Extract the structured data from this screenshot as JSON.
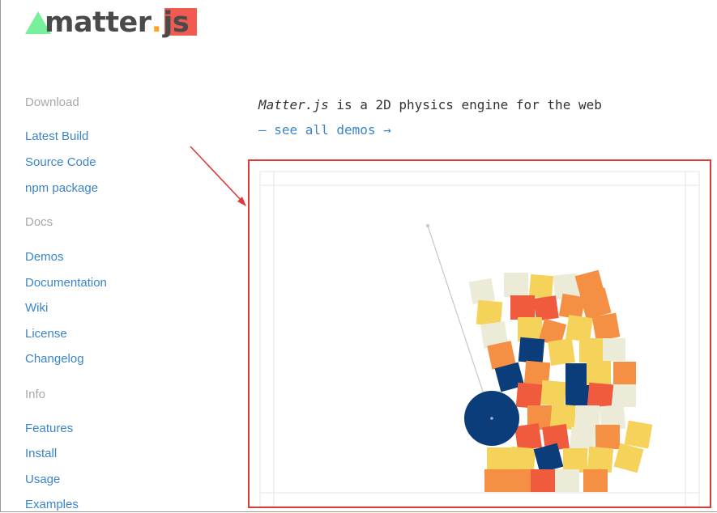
{
  "logo": {
    "word": "matter",
    "dot": ".",
    "js": "js",
    "colors": {
      "triangle": "#76f09b",
      "dot": "#f5a623",
      "js_bg": "#f05a4f",
      "text": "#4a4a4a"
    }
  },
  "sidebar": {
    "sections": [
      {
        "heading": "Download",
        "links": [
          "Latest Build",
          "Source Code",
          "npm package"
        ]
      },
      {
        "heading": "Docs",
        "links": [
          "Demos",
          "Documentation",
          "Wiki",
          "License",
          "Changelog"
        ]
      },
      {
        "heading": "Info",
        "links": [
          "Features",
          "Install",
          "Usage",
          "Examples"
        ]
      }
    ]
  },
  "intro": {
    "emphasis": "Matter.js",
    "rest": " is a 2D physics engine for the web"
  },
  "demos_link": "— see all demos →",
  "demo": {
    "colors": {
      "frame_border": "#dd3a3a",
      "wall": "#e6e6e6",
      "ball": "#0b3d7a",
      "constraint": "#c8c8c8"
    },
    "palette": [
      "#ecebd7",
      "#f5d25a",
      "#f48f44",
      "#f05a3d",
      "#0b3d7a"
    ]
  }
}
